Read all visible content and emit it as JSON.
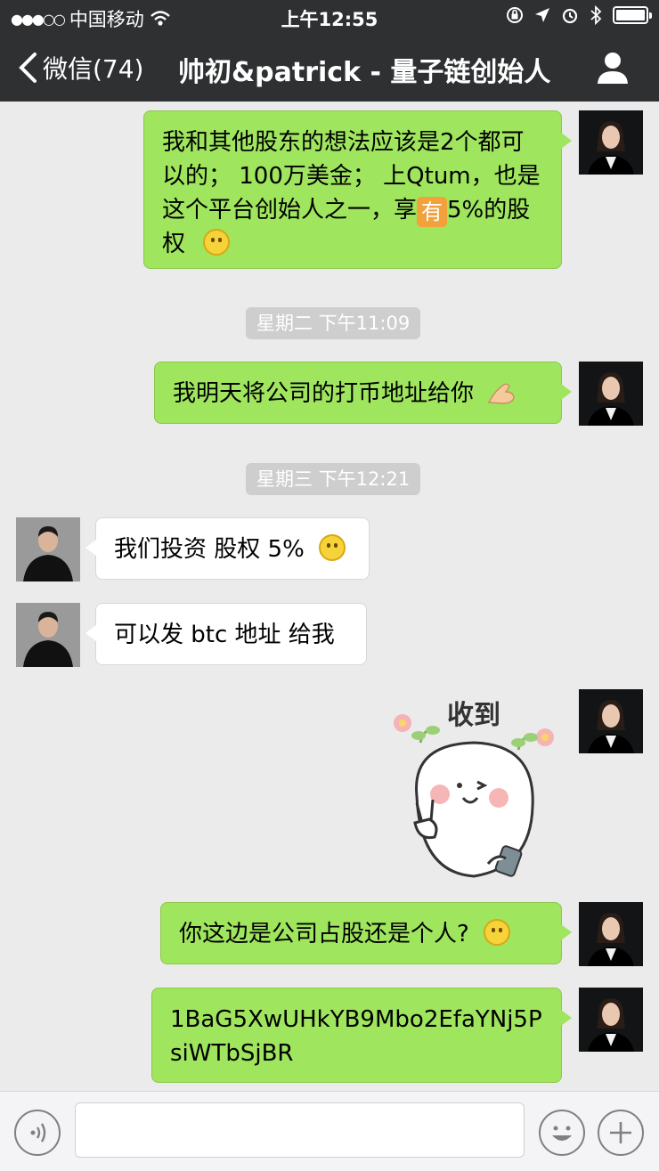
{
  "status_bar": {
    "carrier": "中国移动",
    "time": "上午12:55"
  },
  "nav": {
    "back_label": "微信(74)",
    "title": "帅初&patrick - 量子链创始人"
  },
  "messages": [
    {
      "sender": "me",
      "text": "我和其他股东的想法应该是2个都可以的； 100万美金； 上Qtum，也是这个平台创始人之一，享",
      "emoji_inline": "有",
      "text_after": "5%的股权"
    },
    {
      "timestamp": "星期二 下午11:09"
    },
    {
      "sender": "me",
      "text": "我明天将公司的打币地址给你"
    },
    {
      "timestamp": "星期三 下午12:21"
    },
    {
      "sender": "them",
      "text": "我们投资 股权 5%"
    },
    {
      "sender": "them",
      "text": "可以发 btc 地址 给我"
    },
    {
      "sender": "me",
      "sticker_text": "收到"
    },
    {
      "sender": "me",
      "text": "你这边是公司占股还是个人?"
    },
    {
      "sender": "me",
      "text": "1BaG5XwUHkYB9Mbo2EfaYNj5PsiWTbSjBR"
    }
  ],
  "colors": {
    "header_bg": "#2e3032",
    "my_bubble": "#9fe55e",
    "their_bubble": "#ffffff",
    "chat_bg": "#ebebeb"
  }
}
